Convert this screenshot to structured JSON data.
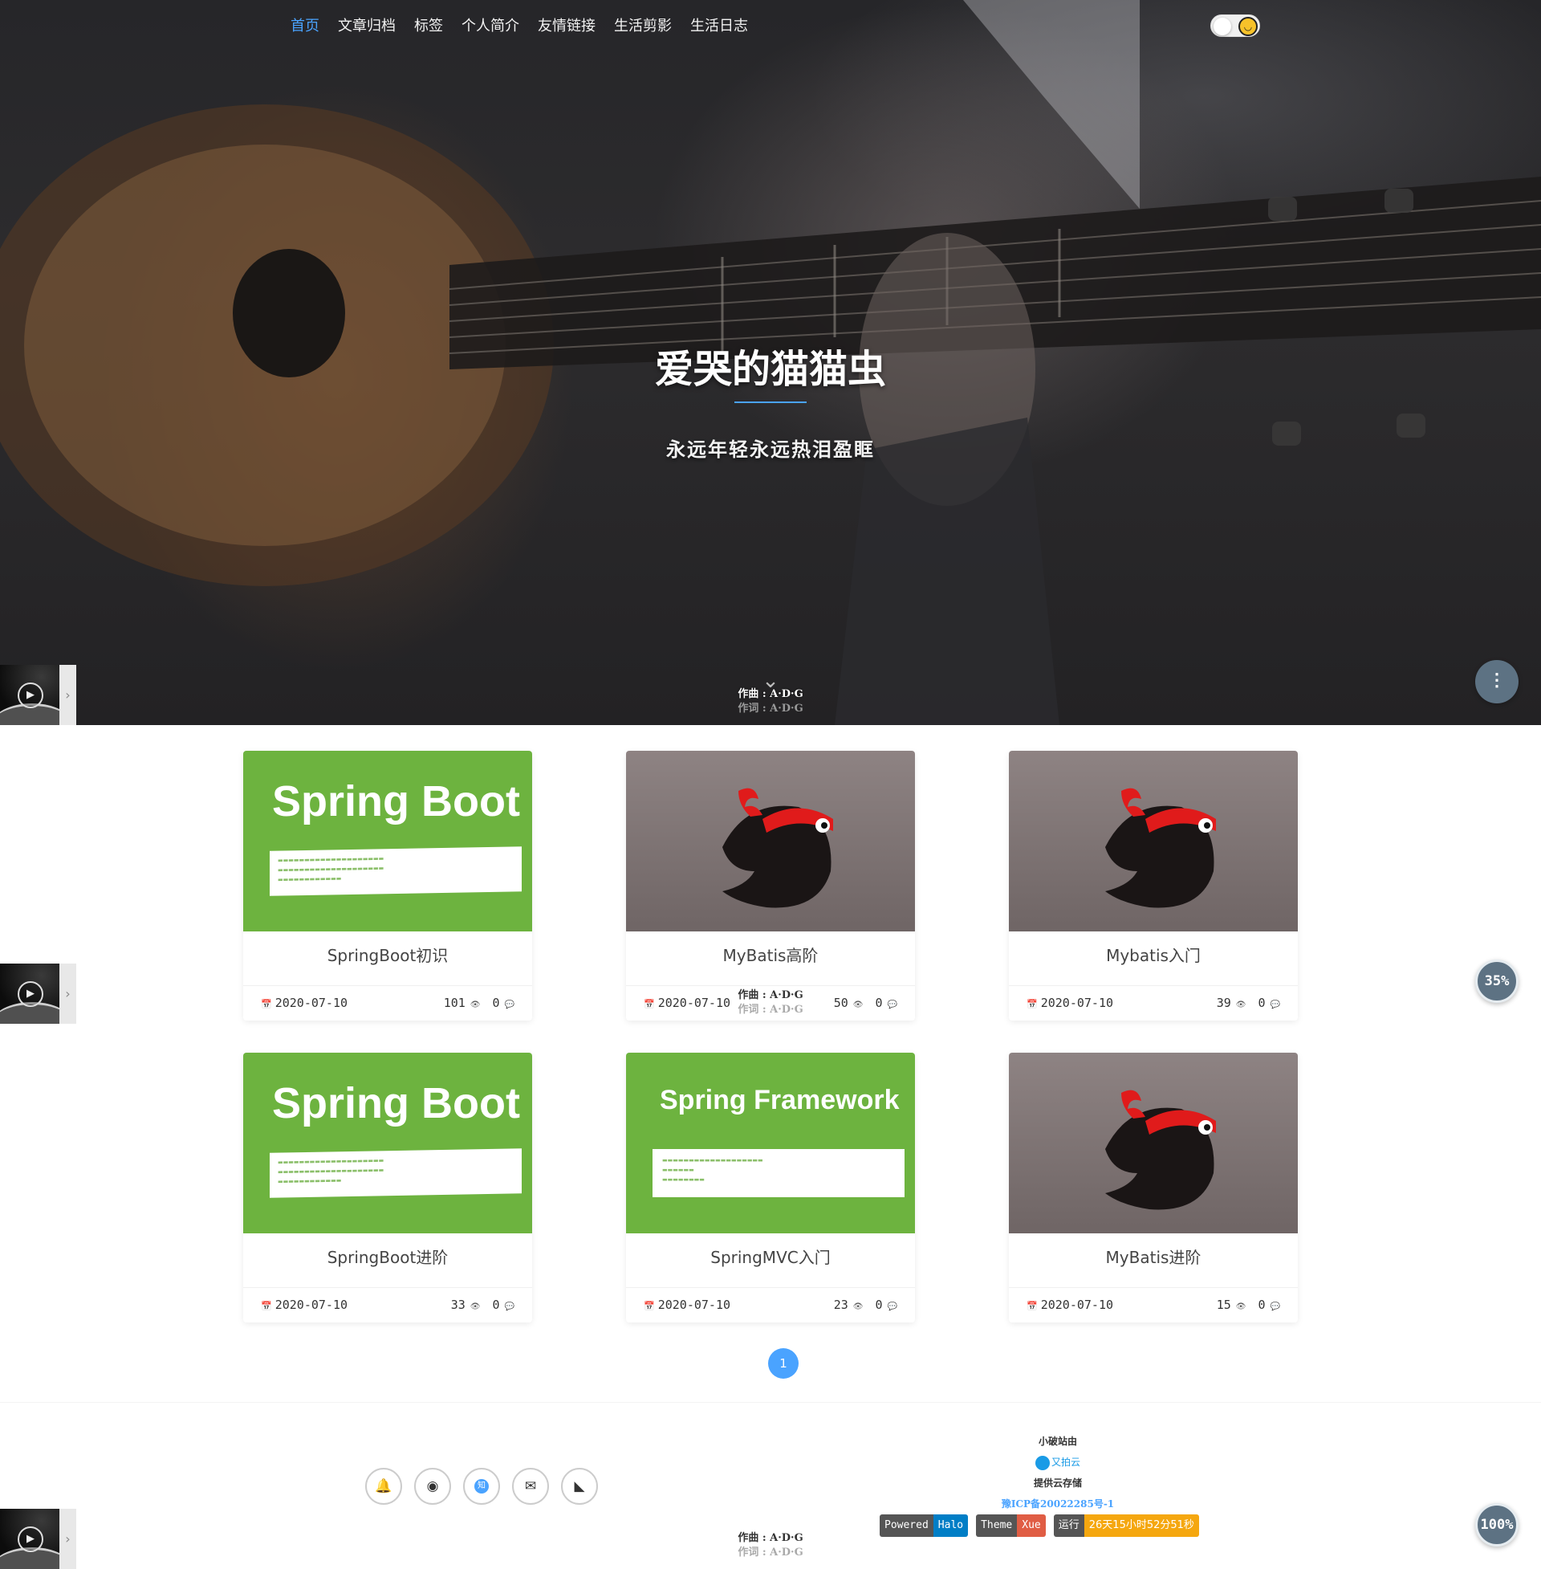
{
  "nav": {
    "items": [
      "首页",
      "文章归档",
      "标签",
      "个人简介",
      "友情链接",
      "生活剪影",
      "生活日志"
    ],
    "active_index": 0
  },
  "hero": {
    "title": "爱哭的猫猫虫",
    "subtitle": "永远年轻永远热泪盈眶",
    "accent_color": "#4aa3ff"
  },
  "lyrics": {
    "line1": "作曲 : A·D·G",
    "line2": "作词 : A·D·G"
  },
  "player": {
    "play_icon": "play-circle-icon",
    "expand_icon": "chevron-right-icon"
  },
  "fabs": {
    "menu_icon": "more-vertical-icon",
    "read_progress": "35%",
    "page_progress": "100%"
  },
  "posts": [
    {
      "title": "SpringBoot初识",
      "date": "2020-07-10",
      "views": "101",
      "comments": "0",
      "cover": "spring-boot",
      "cover_text": "Spring Boot"
    },
    {
      "title": "MyBatis高阶",
      "date": "2020-07-10",
      "views": "50",
      "comments": "0",
      "cover": "mybatis",
      "cover_text": ""
    },
    {
      "title": "Mybatis入门",
      "date": "2020-07-10",
      "views": "39",
      "comments": "0",
      "cover": "mybatis",
      "cover_text": ""
    },
    {
      "title": "SpringBoot进阶",
      "date": "2020-07-10",
      "views": "33",
      "comments": "0",
      "cover": "spring-boot",
      "cover_text": "Spring Boot"
    },
    {
      "title": "SpringMVC入门",
      "date": "2020-07-10",
      "views": "23",
      "comments": "0",
      "cover": "spring-framework",
      "cover_text": "Spring Framework"
    },
    {
      "title": "MyBatis进阶",
      "date": "2020-07-10",
      "views": "15",
      "comments": "0",
      "cover": "mybatis",
      "cover_text": ""
    }
  ],
  "pagination": {
    "current": "1"
  },
  "footer": {
    "social_icons": [
      "qq-icon",
      "github-icon",
      "zhihu-icon",
      "email-icon",
      "rss-icon"
    ],
    "zhihu_glyph": "知",
    "site_label": "小破站由",
    "upyun": "又拍云",
    "storage": "提供云存储",
    "icp": "豫ICP备20022285号-1",
    "badges": [
      {
        "key": "Powered",
        "value": "Halo",
        "color": "#007ec6"
      },
      {
        "key": "Theme",
        "value": "Xue",
        "color": "#e05d44"
      },
      {
        "key": "运行",
        "value": "26天15小时52分51秒",
        "color": "#f5a70f"
      }
    ]
  }
}
